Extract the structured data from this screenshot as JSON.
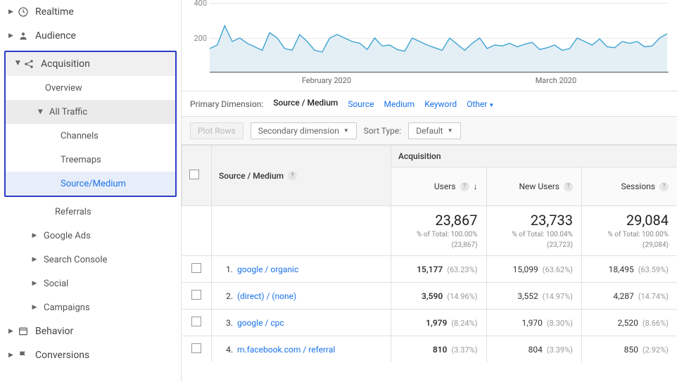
{
  "sidebar": {
    "realtime": "Realtime",
    "audience": "Audience",
    "acquisition": "Acquisition",
    "overview": "Overview",
    "all_traffic": "All Traffic",
    "channels": "Channels",
    "treemaps": "Treemaps",
    "source_medium": "Source/Medium",
    "referrals": "Referrals",
    "google_ads": "Google Ads",
    "search_console": "Search Console",
    "social": "Social",
    "campaigns": "Campaigns",
    "behavior": "Behavior",
    "conversions": "Conversions"
  },
  "chart_data": {
    "type": "line",
    "title": "",
    "xlabel": "",
    "ylabel": "",
    "ylim": [
      0,
      400
    ],
    "y_ticks": [
      200,
      400
    ],
    "x_categories": [
      "February 2020",
      "March 2020"
    ],
    "series": [
      {
        "name": "Users",
        "values": [
          140,
          160,
          270,
          180,
          200,
          170,
          150,
          130,
          230,
          200,
          140,
          130,
          220,
          180,
          130,
          120,
          200,
          220,
          200,
          180,
          170,
          135,
          200,
          155,
          160,
          135,
          125,
          200,
          180,
          160,
          145,
          130,
          200,
          165,
          130,
          170,
          200,
          140,
          160,
          155,
          170,
          150,
          165,
          175,
          135,
          145,
          160,
          130,
          140,
          200,
          180,
          160,
          195,
          150,
          145,
          180,
          170,
          180,
          150,
          155,
          200,
          225
        ]
      }
    ]
  },
  "dimension": {
    "primary_label": "Primary Dimension:",
    "selected": "Source / Medium",
    "options": [
      "Source",
      "Medium",
      "Keyword",
      "Other"
    ]
  },
  "controls": {
    "plot_rows": "Plot Rows",
    "secondary_dimension": "Secondary dimension",
    "sort_type_label": "Sort Type:",
    "sort_type": "Default"
  },
  "table": {
    "col_source_medium": "Source / Medium",
    "group_acquisition": "Acquisition",
    "col_users": "Users",
    "col_new_users": "New Users",
    "col_sessions": "Sessions",
    "totals": {
      "users": {
        "value": "23,867",
        "sub1": "% of Total: 100.00%",
        "sub2": "(23,867)"
      },
      "new_users": {
        "value": "23,733",
        "sub1": "% of Total: 100.04%",
        "sub2": "(23,723)"
      },
      "sessions": {
        "value": "29,084",
        "sub1": "% of Total: 100.00%",
        "sub2": "(29,084)"
      }
    },
    "rows": [
      {
        "idx": "1.",
        "label": "google / organic",
        "users": "15,177",
        "users_pct": "(63.23%)",
        "new_users": "15,099",
        "new_users_pct": "(63.62%)",
        "sessions": "18,495",
        "sessions_pct": "(63.59%)"
      },
      {
        "idx": "2.",
        "label": "(direct) / (none)",
        "users": "3,590",
        "users_pct": "(14.96%)",
        "new_users": "3,552",
        "new_users_pct": "(14.97%)",
        "sessions": "4,287",
        "sessions_pct": "(14.74%)"
      },
      {
        "idx": "3.",
        "label": "google / cpc",
        "users": "1,979",
        "users_pct": "(8.24%)",
        "new_users": "1,970",
        "new_users_pct": "(8.30%)",
        "sessions": "2,520",
        "sessions_pct": "(8.66%)"
      },
      {
        "idx": "4.",
        "label": "m.facebook.com / referral",
        "users": "810",
        "users_pct": "(3.37%)",
        "new_users": "804",
        "new_users_pct": "(3.39%)",
        "sessions": "850",
        "sessions_pct": "(2.92%)"
      }
    ]
  }
}
